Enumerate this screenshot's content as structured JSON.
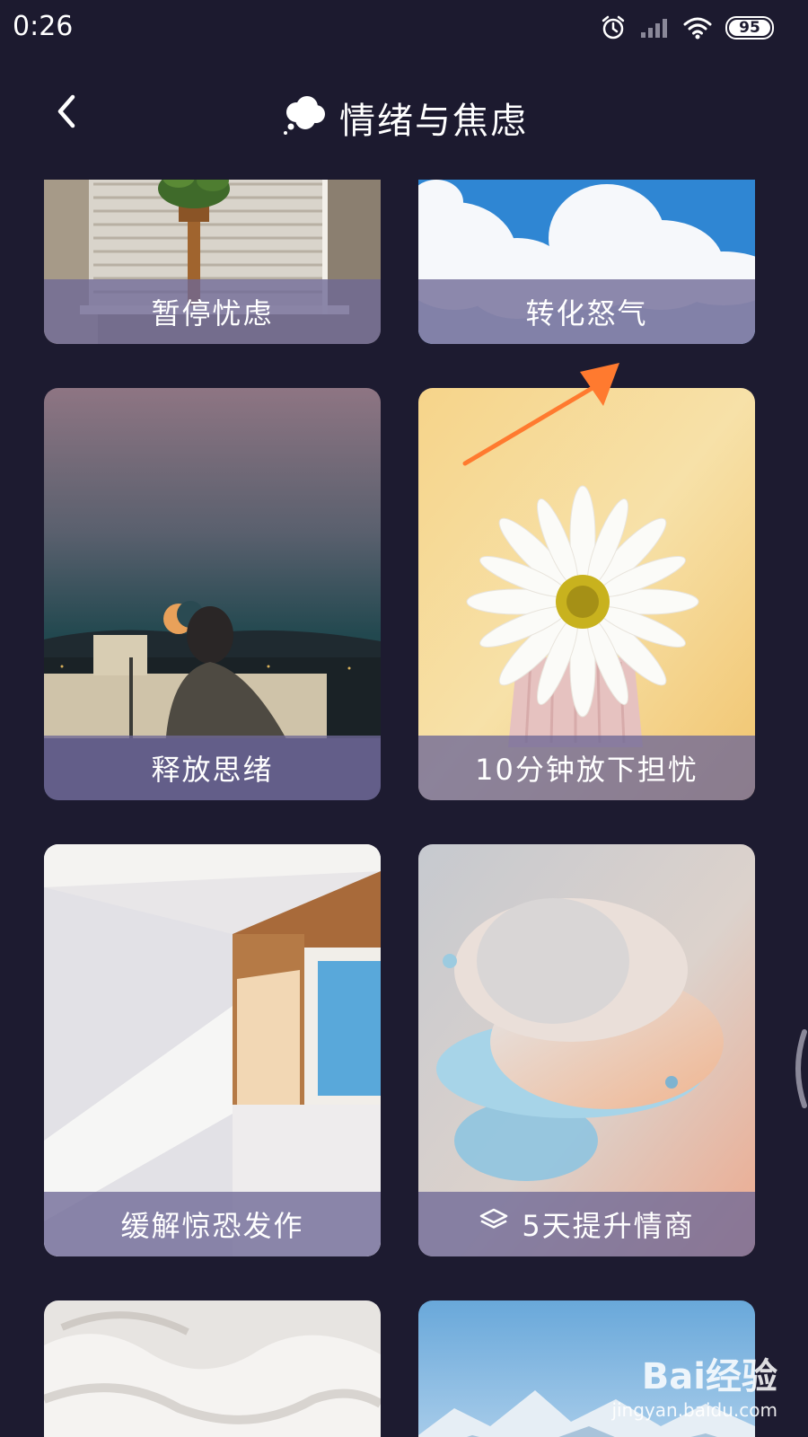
{
  "status_bar": {
    "time": "0:26",
    "battery": "95",
    "icons": [
      "alarm-icon",
      "signal-icon",
      "wifi-icon",
      "battery-icon"
    ]
  },
  "header": {
    "back_icon": "chevron-left-icon",
    "title_icon": "thought-bubble-icon",
    "title": "情绪与焦虑"
  },
  "cards": [
    {
      "label": "暂停忧虑",
      "art": "window-with-plant-photo"
    },
    {
      "label": "转化怒气",
      "art": "clouds-blue-sky-photo"
    },
    {
      "label": "释放思绪",
      "art": "moon-over-city-photo"
    },
    {
      "label": "10分钟放下担忧",
      "art": "white-daisy-photo"
    },
    {
      "label": "缓解惊恐发作",
      "art": "sunlit-room-corner-photo"
    },
    {
      "label": "5天提升情商",
      "art": "abstract-discs-render",
      "icon": "layers-icon"
    },
    {
      "label": "",
      "art": "white-bedding-photo"
    },
    {
      "label": "",
      "art": "snowy-mountains-photo"
    }
  ],
  "annotation": {
    "type": "orange-arrow",
    "points_to": "转化怒气"
  },
  "colors": {
    "background": "#1d1b30",
    "label_overlay": "#6e6896",
    "arrow": "#ff7a2f"
  },
  "watermark": {
    "logo": "Bai经验",
    "site": "jingyan.baidu.com"
  }
}
